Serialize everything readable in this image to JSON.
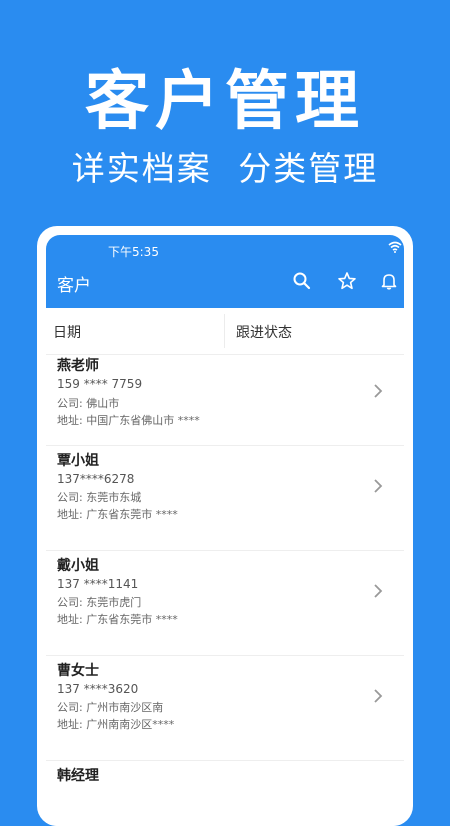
{
  "promo": {
    "title": "客户管理",
    "subtitle": "详实档案 分类管理"
  },
  "status_bar": {
    "time": "下午5:35"
  },
  "app_bar": {
    "title": "客户",
    "icons": [
      "search-icon",
      "star-icon",
      "bell-icon"
    ]
  },
  "filters": {
    "date_label": "日期",
    "status_label": "跟进状态"
  },
  "customers": [
    {
      "name": "燕老师",
      "phone": "159 **** 7759",
      "company": "公司: 佛山市",
      "address": "地址: 中国广东省佛山市 ****"
    },
    {
      "name": "覃小姐",
      "phone": "137****6278",
      "company": "公司: 东莞市东城",
      "address": "地址: 广东省东莞市 ****"
    },
    {
      "name": "戴小姐",
      "phone": "137 ****1141",
      "company": "公司: 东莞市虎门",
      "address": "地址: 广东省东莞市 ****"
    },
    {
      "name": "曹女士",
      "phone": "137 ****3620",
      "company": "公司: 广州市南沙区南",
      "address": "地址: 广州南南沙区****"
    },
    {
      "name": "韩经理",
      "phone": "",
      "company": "",
      "address": ""
    }
  ],
  "colors": {
    "primary": "#2a8cf0",
    "background": "#2a8cf0"
  }
}
